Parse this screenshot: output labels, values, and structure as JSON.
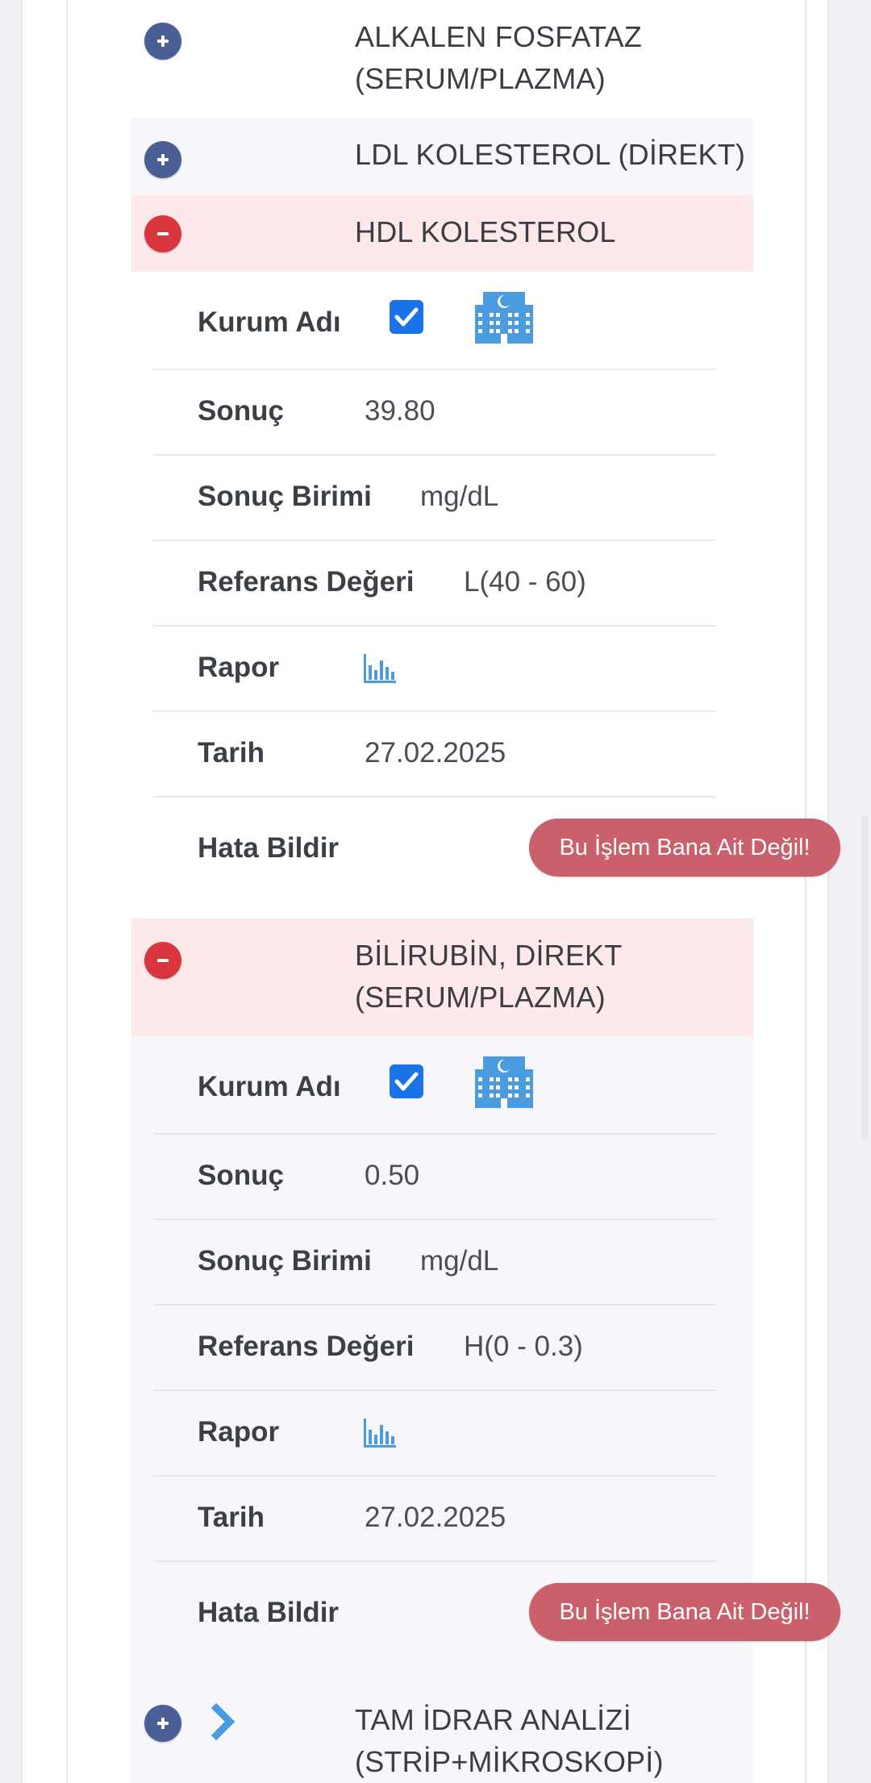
{
  "tests": [
    {
      "name_line1": "ALKALEN FOSFATAZ",
      "name_line2": "(SERUM/PLAZMA)",
      "state": "collapsed"
    },
    {
      "name_line1": "LDL KOLESTEROL (DİREKT)",
      "state": "collapsed"
    },
    {
      "name_line1": "HDL KOLESTEROL",
      "state": "expanded",
      "details": {
        "institution_label": "Kurum Adı",
        "institution_checked": true,
        "institution_icon": "hospital-building-icon",
        "result_label": "Sonuç",
        "result_value": "39.80",
        "unit_label": "Sonuç Birimi",
        "unit_value": "mg/dL",
        "reference_label": "Referans Değeri",
        "reference_value": "L(40 - 60)",
        "report_label": "Rapor",
        "report_icon": "bar-chart-icon",
        "date_label": "Tarih",
        "date_value": "27.02.2025",
        "error_label": "Hata Bildir",
        "error_button": "Bu İşlem Bana Ait Değil!"
      }
    },
    {
      "name_line1": "BİLİRUBİN, DİREKT",
      "name_line2": "(SERUM/PLAZMA)",
      "state": "expanded",
      "details": {
        "institution_label": "Kurum Adı",
        "institution_checked": true,
        "institution_icon": "hospital-building-icon",
        "result_label": "Sonuç",
        "result_value": "0.50",
        "unit_label": "Sonuç Birimi",
        "unit_value": "mg/dL",
        "reference_label": "Referans Değeri",
        "reference_value": "H(0 - 0.3)",
        "report_label": "Rapor",
        "report_icon": "bar-chart-icon",
        "date_label": "Tarih",
        "date_value": "27.02.2025",
        "error_label": "Hata Bildir",
        "error_button": "Bu İşlem Bana Ait Değil!"
      }
    },
    {
      "name_line1": "TAM İDRAR ANALİZİ",
      "name_line2": "(STRİP+MİKROSKOPİ)",
      "state": "collapsed",
      "has_chevron": true
    }
  ],
  "colors": {
    "expand_toggle": "#4a5f96",
    "collapse_toggle": "#d9353f",
    "expanded_header_bg": "#fde8ea",
    "checkbox": "#1a73e8",
    "report_button": "#c9606b",
    "icon_blue": "#4a9be0"
  }
}
